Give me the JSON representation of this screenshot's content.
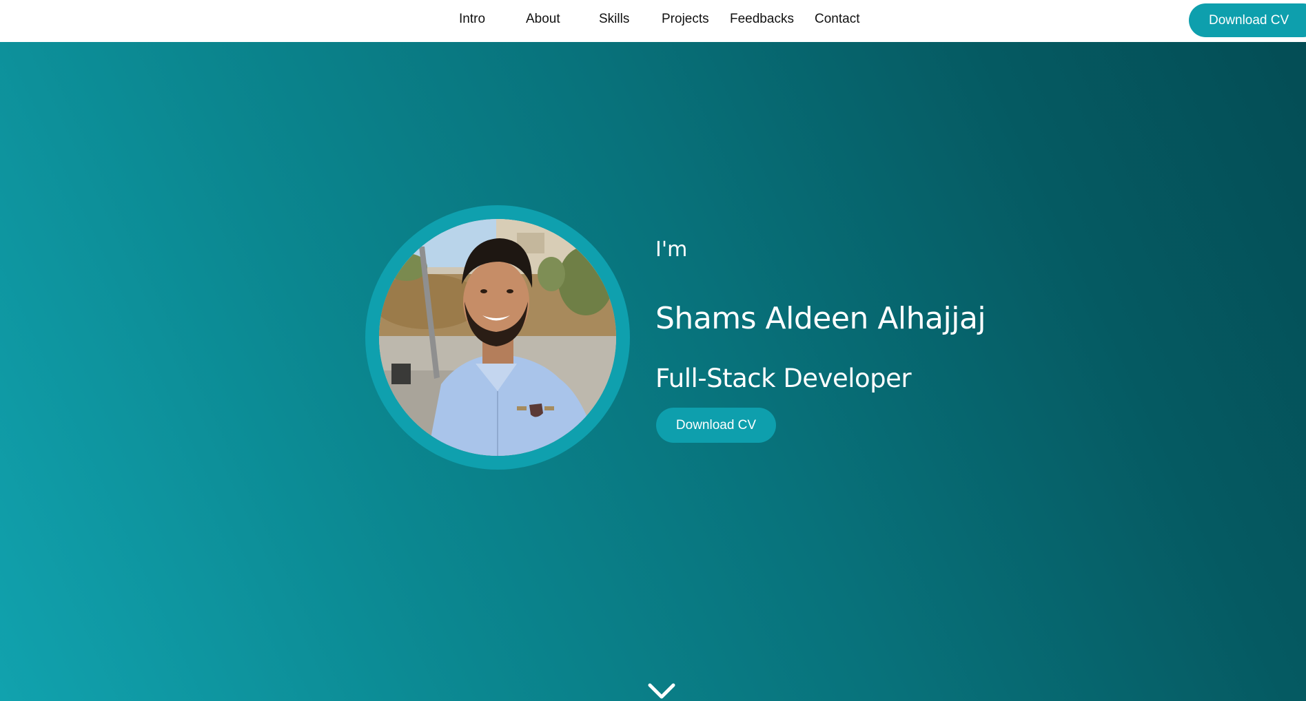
{
  "nav": {
    "links": [
      {
        "label": "Intro"
      },
      {
        "label": "About"
      },
      {
        "label": "Skills"
      },
      {
        "label": "Projects"
      },
      {
        "label": "Feedbacks"
      },
      {
        "label": "Contact"
      }
    ],
    "cv_button": "Download CV"
  },
  "hero": {
    "greeting": "I'm",
    "name": "Shams Aldeen Alhajjaj",
    "role": "Full-Stack Developer",
    "cv_button": "Download CV",
    "photo_icon": "profile-photo",
    "scroll_icon": "chevron-down-icon"
  },
  "colors": {
    "accent": "#0e9fad",
    "hero_gradient_start": "#11a2ae",
    "hero_gradient_end": "#044d55",
    "nav_background": "#ffffff"
  }
}
